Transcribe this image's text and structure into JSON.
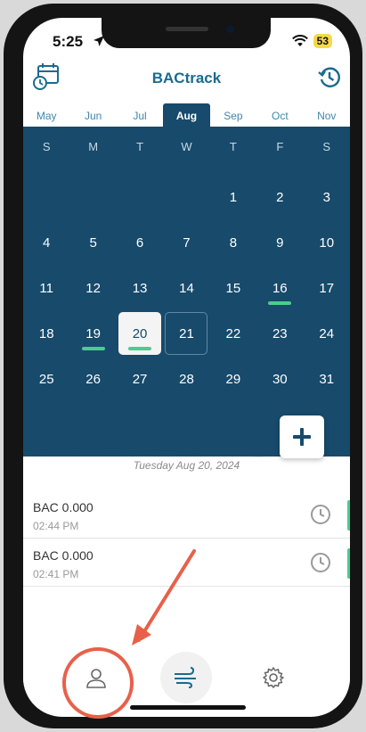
{
  "status": {
    "time": "5:25",
    "battery": "53"
  },
  "header": {
    "title": "BACtrack"
  },
  "months": [
    "May",
    "Jun",
    "Jul",
    "Aug",
    "Sep",
    "Oct",
    "Nov"
  ],
  "weekdays": [
    "S",
    "M",
    "T",
    "W",
    "T",
    "F",
    "S"
  ],
  "calendar": {
    "month": "Aug",
    "weeks": [
      [
        "",
        "",
        "",
        "",
        "1",
        "2",
        "3"
      ],
      [
        "4",
        "5",
        "6",
        "7",
        "8",
        "9",
        "10"
      ],
      [
        "11",
        "12",
        "13",
        "14",
        "15",
        "16",
        "17"
      ],
      [
        "18",
        "19",
        "20",
        "21",
        "22",
        "23",
        "24"
      ],
      [
        "25",
        "26",
        "27",
        "28",
        "29",
        "30",
        "31"
      ]
    ],
    "selected_day": "20",
    "today_day": "21",
    "days_with_readings": [
      "16",
      "19",
      "20"
    ]
  },
  "selected_date_label": "Tuesday Aug 20, 2024",
  "readings": [
    {
      "bac": "BAC 0.000",
      "time": "02:44 PM"
    },
    {
      "bac": "BAC 0.000",
      "time": "02:41 PM"
    }
  ],
  "tabbar": {
    "items": [
      {
        "name": "profile",
        "icon": "person-icon"
      },
      {
        "name": "breath-test",
        "icon": "wind-icon"
      },
      {
        "name": "settings",
        "icon": "gear-icon"
      }
    ]
  },
  "colors": {
    "calendar_bg": "#174a6b",
    "accent_blue": "#1a6b8f",
    "reading_marker": "#4ecb8e",
    "annotation": "#e8604a"
  }
}
